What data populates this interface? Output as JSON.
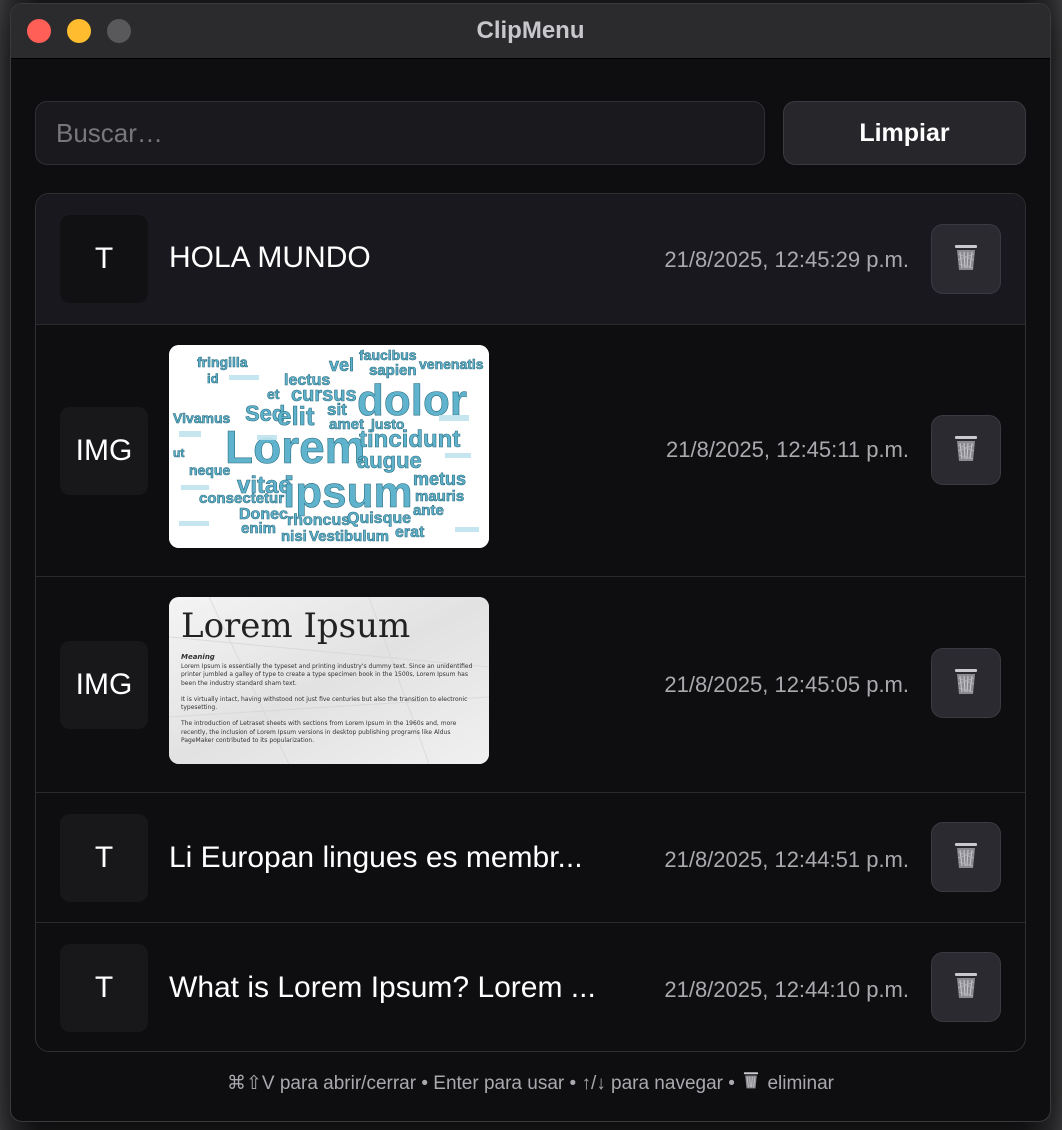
{
  "window": {
    "title": "ClipMenu"
  },
  "search": {
    "placeholder": "Buscar…",
    "value": ""
  },
  "toolbar": {
    "clear_label": "Limpiar"
  },
  "items": [
    {
      "type": "T",
      "kind": "text",
      "preview": "HOLA MUNDO",
      "timestamp": "21/8/2025, 12:45:29 p.m.",
      "selected": true
    },
    {
      "type": "IMG",
      "kind": "image",
      "image_desc": "word-cloud",
      "image_words": [
        "fringilla",
        "faucibus",
        "vel",
        "sapien",
        "venenatis",
        "lectus",
        "cursus",
        "dolor",
        "Vivamus",
        "Sed",
        "elit",
        "sit",
        "amet",
        "Lorem",
        "tincidunt",
        "augue",
        "neque",
        "vitae",
        "ipsum",
        "metus",
        "mauris",
        "consectetur",
        "Donec",
        "enim",
        "rhoncus",
        "Quisque",
        "nisi",
        "Vestibulum",
        "erat",
        "ante",
        "id",
        "et",
        "ut",
        "justo"
      ],
      "timestamp": "21/8/2025, 12:45:11 p.m."
    },
    {
      "type": "IMG",
      "kind": "image",
      "image_desc": "document",
      "doc_title": "Lorem Ipsum",
      "doc_heading": "Meaning",
      "doc_paragraphs": [
        "Lorem Ipsum is essentially the typeset and printing industry's dummy text. Since an unidentified printer jumbled a galley of type to create a type specimen book in the 1500s, Lorem Ipsum has been the industry standard sham text.",
        "It is virtually intact, having withstood not just five centuries but also the transition to electronic typesetting.",
        "The introduction of Letraset sheets with sections from Lorem Ipsum in the 1960s and, more recently, the inclusion of Lorem Ipsum versions in desktop publishing programs like Aldus PageMaker contributed to its popularization."
      ],
      "timestamp": "21/8/2025, 12:45:05 p.m."
    },
    {
      "type": "T",
      "kind": "text",
      "preview": "Li Europan lingues es membr...",
      "timestamp": "21/8/2025, 12:44:51 p.m."
    },
    {
      "type": "T",
      "kind": "text",
      "preview": "What is Lorem Ipsum? Lorem ...",
      "timestamp": "21/8/2025, 12:44:10 p.m."
    }
  ],
  "footer": {
    "hint_before_icon": "⌘⇧V para abrir/cerrar • Enter para usar • ↑/↓ para navegar •",
    "icon": "trash-icon",
    "hint_after_icon": "eliminar"
  },
  "colors": {
    "close": "#ff5f57",
    "minimize": "#febc2e",
    "zoom_disabled": "#59595c",
    "window_bg": "#0e0e10",
    "accent_text": "#ffffff",
    "muted_text": "#a9a9ae"
  }
}
